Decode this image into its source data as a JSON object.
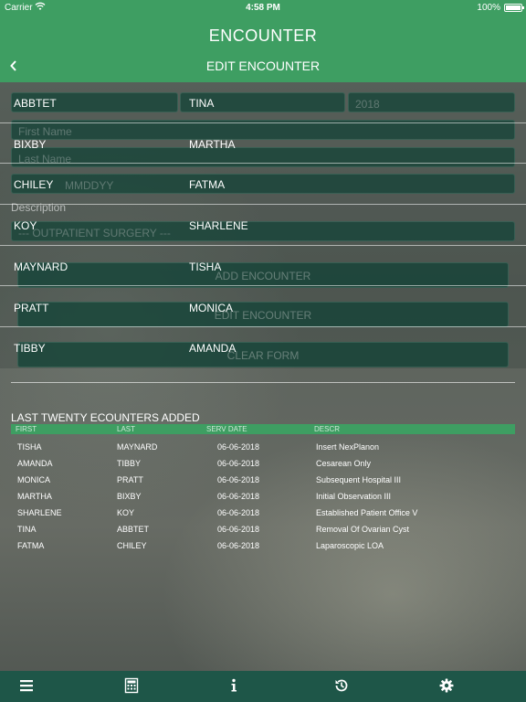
{
  "status_bar": {
    "carrier": "Carrier",
    "time": "4:58 PM",
    "battery": "100%"
  },
  "header": {
    "title": "ENCOUNTER",
    "subtitle": "EDIT ENCOUNTER",
    "back_icon": "chevron-left-icon"
  },
  "form": {
    "year_value": "2018",
    "first_name_placeholder": "First Name",
    "last_name_placeholder": "Last Name",
    "date_placeholder": "MMDDYY",
    "description_label": "Description",
    "description_value": "--- OUTPATIENT SURGERY ---",
    "add_button": "ADD ENCOUNTER",
    "edit_button": "EDIT ENCOUNTER",
    "clear_button": "CLEAR FORM"
  },
  "patient_dropdown": [
    {
      "last": "ABBTET",
      "first": "TINA"
    },
    {
      "last": "BIXBY",
      "first": "MARTHA"
    },
    {
      "last": "CHILEY",
      "first": "FATMA"
    },
    {
      "last": "KOY",
      "first": "SHARLENE"
    },
    {
      "last": "MAYNARD",
      "first": "TISHA"
    },
    {
      "last": "PRATT",
      "first": "MONICA"
    },
    {
      "last": "TIBBY",
      "first": "AMANDA"
    }
  ],
  "recent": {
    "title": "LAST TWENTY ECOUNTERS ADDED",
    "columns": [
      "FIRST",
      "LAST",
      "SERV DATE",
      "DESCR"
    ],
    "rows": [
      {
        "first": "TISHA",
        "last": "MAYNARD",
        "date": "06-06-2018",
        "descr": "Insert NexPlanon"
      },
      {
        "first": "AMANDA",
        "last": "TIBBY",
        "date": "06-06-2018",
        "descr": "Cesarean Only"
      },
      {
        "first": "MONICA",
        "last": "PRATT",
        "date": "06-06-2018",
        "descr": "Subsequent Hospital III"
      },
      {
        "first": "MARTHA",
        "last": "BIXBY",
        "date": "06-06-2018",
        "descr": "Initial Observation III"
      },
      {
        "first": "SHARLENE",
        "last": "KOY",
        "date": "06-06-2018",
        "descr": "Established Patient Office V"
      },
      {
        "first": "TINA",
        "last": "ABBTET",
        "date": "06-06-2018",
        "descr": "Removal Of Ovarian Cyst"
      },
      {
        "first": "FATMA",
        "last": "CHILEY",
        "date": "06-06-2018",
        "descr": "Laparoscopic LOA"
      }
    ]
  },
  "toolbar": {
    "items": [
      "menu-icon",
      "calculator-icon",
      "info-icon",
      "history-icon",
      "gear-icon"
    ]
  },
  "colors": {
    "header_green": "#3e9e62",
    "toolbar_green": "#1e5648",
    "field_bg": "#0c483a"
  }
}
